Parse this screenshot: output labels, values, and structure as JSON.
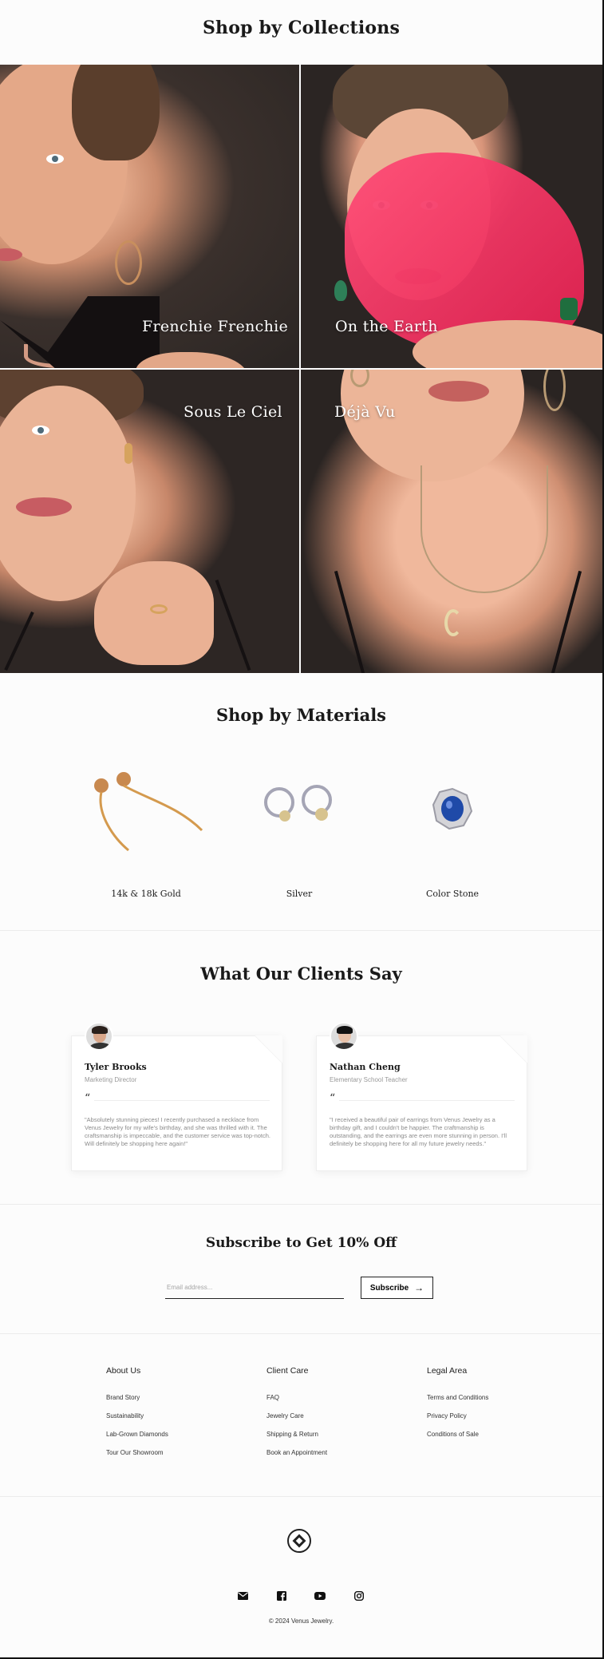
{
  "collections": {
    "title": "Shop by Collections",
    "items": [
      {
        "label": "Frenchie Frenchie"
      },
      {
        "label": "On the Earth"
      },
      {
        "label": "Sous Le Ciel"
      },
      {
        "label": "Déjà Vu"
      }
    ]
  },
  "materials": {
    "title": "Shop by Materials",
    "items": [
      {
        "label": "14k & 18k Gold"
      },
      {
        "label": "Silver"
      },
      {
        "label": "Color Stone"
      }
    ]
  },
  "testimonials": {
    "title": "What Our Clients Say",
    "quote_mark": "“",
    "items": [
      {
        "name": "Tyler Brooks",
        "role": "Marketing Director",
        "text": "\"Absolutely stunning pieces! I recently purchased a necklace from Venus Jewelry for my wife's birthday, and she was thrilled with it. The craftsmanship is impeccable, and the customer service was top-notch. Will definitely be shopping here again!\""
      },
      {
        "name": "Nathan Cheng",
        "role": "Elementary School Teacher",
        "text": "\"I received a beautiful pair of earrings from Venus Jewelry as a birthday gift, and I couldn't be happier. The craftmanship is outstanding, and the earrings are even more stunning in person. I'll definitely be shopping here for all my future jewelry needs.\""
      }
    ]
  },
  "subscribe": {
    "title": "Subscribe to Get 10% Off",
    "placeholder": "Email address...",
    "button_label": "Subscribe",
    "button_arrow": "→"
  },
  "footer": {
    "columns": [
      {
        "heading": "About Us",
        "links": [
          "Brand Story",
          "Sustainability",
          "Lab-Grown Diamonds",
          "Tour Our Showroom"
        ]
      },
      {
        "heading": "Client Care",
        "links": [
          "FAQ",
          "Jewelry Care",
          "Shipping & Return",
          "Book an Appointment"
        ]
      },
      {
        "heading": "Legal Area",
        "links": [
          "Terms and Conditions",
          "Privacy Policy",
          "Conditions of Sale"
        ]
      }
    ],
    "socials": [
      "mail-icon",
      "facebook-icon",
      "youtube-icon",
      "instagram-icon"
    ],
    "copyright": "© 2024 Venus Jewelry."
  },
  "colors": {
    "background": "#fcfcfc",
    "text": "#1a1a1a",
    "accent_fabric": "#e32050",
    "muted_text": "#8a8a8a"
  }
}
